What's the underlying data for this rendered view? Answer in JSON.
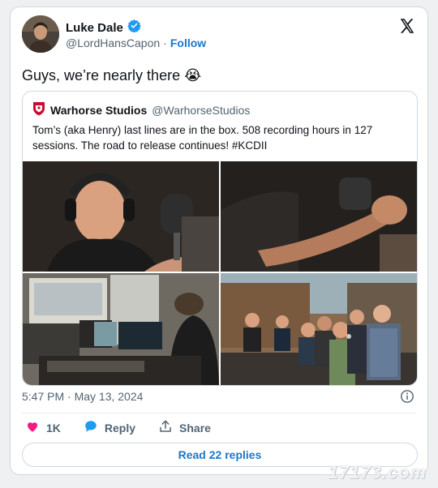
{
  "author": {
    "name": "Luke Dale",
    "handle": "@LordHansCapon",
    "separator": "·",
    "follow_label": "Follow",
    "verified_icon": "verified-badge-icon"
  },
  "tweet": {
    "text": "Guys, we’re nearly there",
    "emoji": "😭"
  },
  "quote": {
    "name": "Warhorse Studios",
    "handle": "@WarhorseStudios",
    "text": "Tom’s (aka Henry) last lines are in the box. 508 recording hours in 127 sessions. The road to release continues! #KCDII",
    "logo_icon": "warhorse-shield-icon"
  },
  "meta": {
    "timestamp": "5:47 PM · May 13, 2024"
  },
  "actions": {
    "likes": "1K",
    "reply_label": "Reply",
    "share_label": "Share"
  },
  "read_replies_label": "Read 22 replies",
  "watermark": "17173.com",
  "colors": {
    "accent": "#1d77c8",
    "like": "#f91880",
    "verified": "#1d9bf0"
  }
}
